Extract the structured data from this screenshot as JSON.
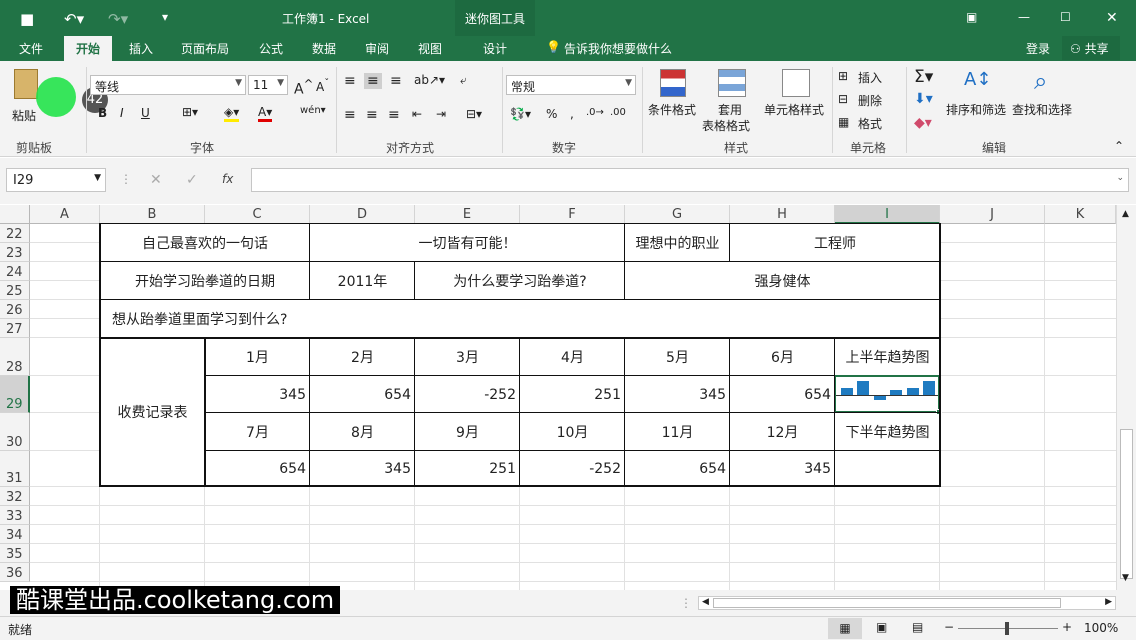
{
  "window": {
    "title": "工作簿1 - Excel",
    "tools_tab": "迷你图工具"
  },
  "tabs": [
    "文件",
    "开始",
    "插入",
    "页面布局",
    "公式",
    "数据",
    "审阅",
    "视图",
    "设计"
  ],
  "tell_me": "告诉我你想要做什么",
  "account": {
    "login": "登录",
    "share": "共享"
  },
  "ribbon": {
    "clipboard": {
      "paste": "粘贴",
      "group": "剪贴板",
      "badge": "42"
    },
    "font": {
      "name": "等线",
      "size": "11",
      "group": "字体",
      "bold": "B",
      "italic": "I",
      "underline": "U"
    },
    "alignment": {
      "group": "对齐方式"
    },
    "number": {
      "format": "常规",
      "group": "数字",
      "percent": "%"
    },
    "styles": {
      "conditional": "条件格式",
      "table1": "套用",
      "table2": "表格格式",
      "cell_styles": "单元格样式",
      "group": "样式"
    },
    "cells": {
      "insert": "插入",
      "delete": "删除",
      "format": "格式",
      "group": "单元格"
    },
    "editing": {
      "sort": "排序和筛选",
      "find": "查找和选择",
      "group": "编辑"
    }
  },
  "namebox": "I29",
  "fx": "fx",
  "columns": [
    "A",
    "B",
    "C",
    "D",
    "E",
    "F",
    "G",
    "H",
    "I",
    "J",
    "K"
  ],
  "rows": [
    "22",
    "23",
    "24",
    "25",
    "26",
    "27",
    "28",
    "29",
    "30",
    "31",
    "32",
    "33",
    "34",
    "35",
    "36"
  ],
  "cells": {
    "r22_b": "自己最喜欢的一句话",
    "r22_d": "一切皆有可能！",
    "r22_g": "理想中的职业",
    "r22_h": "工程师",
    "r24_b": "开始学习跆拳道的日期",
    "r24_d": "2011年",
    "r24_e": "为什么要学习跆拳道?",
    "r24_g": "强身健体",
    "r26_b": "想从跆拳道里面学习到什么?",
    "fee": "收费记录表",
    "months1": [
      "1月",
      "2月",
      "3月",
      "4月",
      "5月",
      "6月"
    ],
    "values1": [
      "345",
      "654",
      "-252",
      "251",
      "345",
      "654"
    ],
    "months2": [
      "7月",
      "8月",
      "9月",
      "10月",
      "11月",
      "12月"
    ],
    "values2": [
      "654",
      "345",
      "251",
      "-252",
      "654",
      "345"
    ],
    "trend1": "上半年趋势图",
    "trend2": "下半年趋势图"
  },
  "sparkline": {
    "values": [
      345,
      654,
      -252,
      251,
      345,
      654
    ],
    "color": "#1f7bc1"
  },
  "status": {
    "ready": "就绪",
    "zoom": "100%"
  },
  "watermark": "酷课堂出品.coolketang.com"
}
